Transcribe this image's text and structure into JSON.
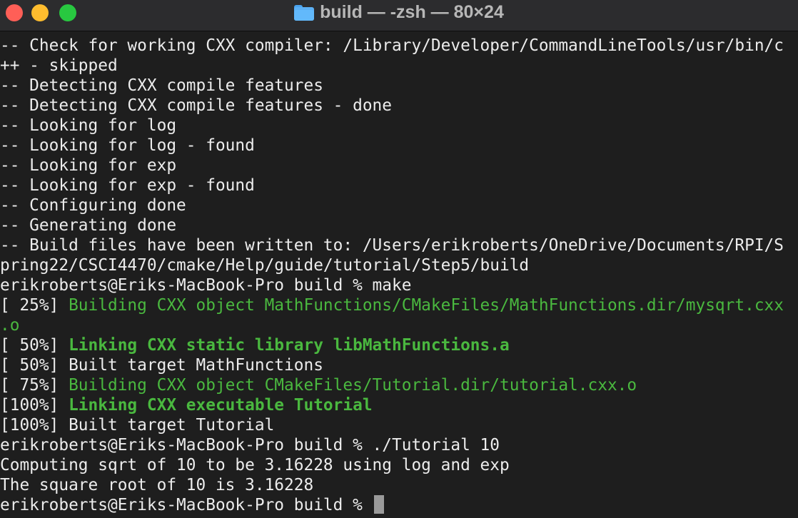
{
  "window": {
    "title": "build — -zsh — 80×24",
    "icon": "folder-icon"
  },
  "colors": {
    "background": "#1e1e1e",
    "titlebar": "#2c2c2e",
    "text": "#ececec",
    "green": "#4ab83f",
    "close": "#ff5f57",
    "minimize": "#febc2e",
    "zoom": "#28c840"
  },
  "terminal": {
    "lines": [
      [
        {
          "text": "-- Check for working CXX compiler: /Library/Developer/CommandLineTools/usr/bin/c",
          "style": "normal"
        }
      ],
      [
        {
          "text": "++ - skipped",
          "style": "normal"
        }
      ],
      [
        {
          "text": "-- Detecting CXX compile features",
          "style": "normal"
        }
      ],
      [
        {
          "text": "-- Detecting CXX compile features - done",
          "style": "normal"
        }
      ],
      [
        {
          "text": "-- Looking for log",
          "style": "normal"
        }
      ],
      [
        {
          "text": "-- Looking for log - found",
          "style": "normal"
        }
      ],
      [
        {
          "text": "-- Looking for exp",
          "style": "normal"
        }
      ],
      [
        {
          "text": "-- Looking for exp - found",
          "style": "normal"
        }
      ],
      [
        {
          "text": "-- Configuring done",
          "style": "normal"
        }
      ],
      [
        {
          "text": "-- Generating done",
          "style": "normal"
        }
      ],
      [
        {
          "text": "-- Build files have been written to: /Users/erikroberts/OneDrive/Documents/RPI/S",
          "style": "normal"
        }
      ],
      [
        {
          "text": "pring22/CSCI4470/cmake/Help/guide/tutorial/Step5/build",
          "style": "normal"
        }
      ],
      [
        {
          "text": "erikroberts@Eriks-MacBook-Pro build % make",
          "style": "normal"
        }
      ],
      [
        {
          "text": "[ 25%] ",
          "style": "normal"
        },
        {
          "text": "Building CXX object MathFunctions/CMakeFiles/MathFunctions.dir/mysqrt.cxx",
          "style": "green"
        }
      ],
      [
        {
          "text": ".o",
          "style": "green"
        }
      ],
      [
        {
          "text": "[ 50%] ",
          "style": "normal"
        },
        {
          "text": "Linking CXX static library libMathFunctions.a",
          "style": "green-bold"
        }
      ],
      [
        {
          "text": "[ 50%] Built target MathFunctions",
          "style": "normal"
        }
      ],
      [
        {
          "text": "[ 75%] ",
          "style": "normal"
        },
        {
          "text": "Building CXX object CMakeFiles/Tutorial.dir/tutorial.cxx.o",
          "style": "green"
        }
      ],
      [
        {
          "text": "[100%] ",
          "style": "normal"
        },
        {
          "text": "Linking CXX executable Tutorial",
          "style": "green-bold"
        }
      ],
      [
        {
          "text": "[100%] Built target Tutorial",
          "style": "normal"
        }
      ],
      [
        {
          "text": "erikroberts@Eriks-MacBook-Pro build % ./Tutorial 10",
          "style": "normal"
        }
      ],
      [
        {
          "text": "Computing sqrt of 10 to be 3.16228 using log and exp",
          "style": "normal"
        }
      ],
      [
        {
          "text": "The square root of 10 is 3.16228",
          "style": "normal"
        }
      ]
    ],
    "prompt": "erikroberts@Eriks-MacBook-Pro build % "
  }
}
